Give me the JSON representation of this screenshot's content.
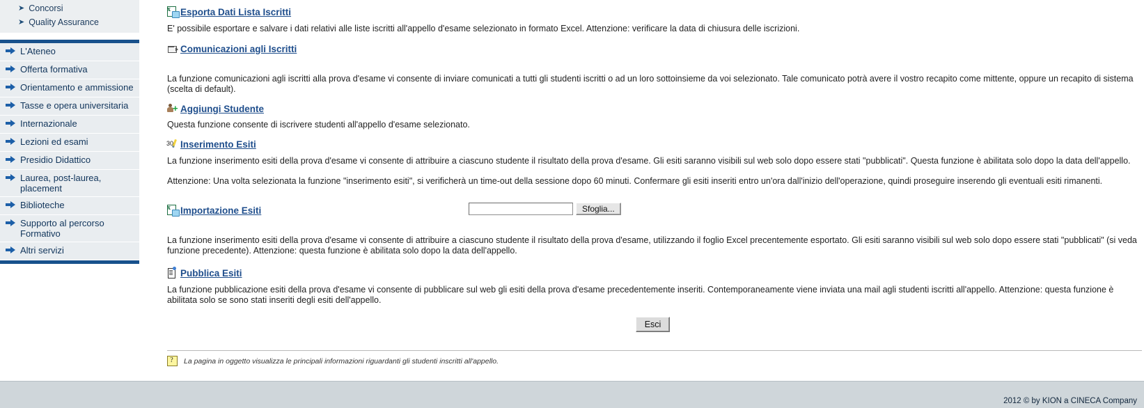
{
  "sidebar": {
    "sub_items": [
      {
        "label": "Concorsi",
        "icon": "arrow-right-icon"
      },
      {
        "label": "Quality Assurance",
        "icon": "arrow-right-icon"
      }
    ],
    "nav_items": [
      {
        "label": "L'Ateneo",
        "icon": "arrow-right-icon"
      },
      {
        "label": "Offerta formativa",
        "icon": "arrow-right-icon"
      },
      {
        "label": "Orientamento e ammissione",
        "icon": "arrow-right-icon"
      },
      {
        "label": "Tasse e opera universitaria",
        "icon": "arrow-right-icon"
      },
      {
        "label": "Internazionale",
        "icon": "arrow-right-icon"
      },
      {
        "label": "Lezioni ed esami",
        "icon": "arrow-right-icon"
      },
      {
        "label": "Presidio Didattico",
        "icon": "arrow-right-icon"
      },
      {
        "label": "Laurea, post-laurea, placement",
        "icon": "arrow-right-icon"
      },
      {
        "label": "Biblioteche",
        "icon": "arrow-right-icon"
      },
      {
        "label": "Supporto al percorso Formativo",
        "icon": "arrow-right-icon"
      },
      {
        "label": "Altri servizi",
        "icon": "arrow-right-icon"
      }
    ]
  },
  "main": {
    "sections": [
      {
        "id": "esporta",
        "link": "Esporta Dati Lista Iscritti",
        "icon": "excel-export-icon",
        "paragraph": "E' possibile esportare e salvare i dati relativi alle liste iscritti all'appello d'esame selezionato in formato Excel. Attenzione: verificare la data di chiusura delle iscrizioni."
      },
      {
        "id": "comunicazioni",
        "link": "Comunicazioni agli Iscritti",
        "icon": "mail-icon",
        "paragraph": "La funzione comunicazioni agli iscritti alla prova d'esame vi consente di inviare comunicati a tutti gli studenti iscritti o ad un loro sottoinsieme da voi selezionato. Tale comunicato potrà avere il vostro recapito come mittente, oppure un recapito di sistema (scelta di default)."
      },
      {
        "id": "aggiungi",
        "link": "Aggiungi Studente",
        "icon": "add-user-icon",
        "paragraph": "Questa funzione consente di iscrivere studenti all'appello d'esame selezionato."
      },
      {
        "id": "inserimento",
        "link": "Inserimento Esiti",
        "icon": "grade-pencil-icon",
        "paragraph": "La funzione inserimento esiti della prova d'esame vi consente di attribuire a ciascuno studente il risultato della prova d'esame. Gli esiti saranno visibili sul web solo dopo essere stati \"pubblicati\". Questa funzione è abilitata solo dopo la data dell'appello.",
        "paragraph2": "Attenzione: Una volta selezionata la funzione \"inserimento esiti\", si verificherà un time-out della sessione dopo 60 minuti. Confermare gli esiti inseriti entro un'ora dall'inizio dell'operazione, quindi proseguire inserendo gli eventuali esiti rimanenti."
      },
      {
        "id": "importazione",
        "link": "Importazione Esiti",
        "icon": "excel-import-icon",
        "paragraph": "La funzione inserimento esiti della prova d'esame vi consente di attribuire a ciascuno studente il risultato della prova d'esame, utilizzando il foglio Excel precentemente esportato. Gli esiti saranno visibili sul web solo dopo essere stati \"pubblicati\" (si veda funzione precedente). Attenzione: questa funzione è abilitata solo dopo la data dell'appello."
      },
      {
        "id": "pubblica",
        "link": "Pubblica Esiti",
        "icon": "publish-doc-icon",
        "paragraph": "La funzione pubblicazione esiti della prova d'esame vi consente di pubblicare sul web gli esiti della prova d'esame precedentemente inseriti. Contemporaneamente viene inviata una mail agli studenti iscritti all'appello. Attenzione: questa funzione è abilitata solo se sono stati inseriti degli esiti dell'appello."
      }
    ],
    "file_field": {
      "value": "",
      "placeholder": "",
      "browse_label": "Sfoglia..."
    },
    "exit_button": "Esci",
    "note": {
      "icon": "help-question-icon",
      "text": "La pagina in oggetto visualizza le principali informazioni riguardanti gli studenti inscritti all'appello."
    }
  },
  "footer": {
    "copyright": "2012 © by KION a CINECA Company"
  },
  "colors": {
    "link": "#1f4e8c",
    "nav_border": "#18518c",
    "nav_bg": "#e9edf0",
    "footer_bg": "#cfd6da"
  }
}
